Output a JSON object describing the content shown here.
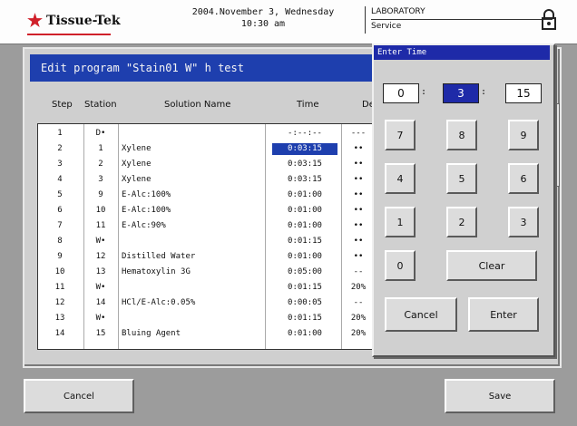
{
  "header": {
    "logo_text": "Tissue-Tek",
    "date_line": "2004.November 3, Wednesday",
    "time_line": "10:30 am",
    "lab_label": "LABORATORY",
    "lab_value": "Service",
    "colors": {
      "logo_star": "#d0202a",
      "title_bg": "#1e3fae"
    }
  },
  "editor": {
    "title": "Edit program \"Stain01 W\" h test",
    "columns": [
      "Step",
      "Station",
      "Solution Name",
      "Time",
      "Del"
    ],
    "rows": [
      {
        "step": "1",
        "station": "D•",
        "solution": "",
        "time": "-:--:--",
        "del": "---"
      },
      {
        "step": "2",
        "station": "1",
        "solution": "Xylene",
        "time": "0:03:15",
        "del": "••"
      },
      {
        "step": "3",
        "station": "2",
        "solution": "Xylene",
        "time": "0:03:15",
        "del": "••"
      },
      {
        "step": "4",
        "station": "3",
        "solution": "Xylene",
        "time": "0:03:15",
        "del": "••"
      },
      {
        "step": "5",
        "station": "9",
        "solution": "E-Alc:100%",
        "time": "0:01:00",
        "del": "••"
      },
      {
        "step": "6",
        "station": "10",
        "solution": "E-Alc:100%",
        "time": "0:01:00",
        "del": "••"
      },
      {
        "step": "7",
        "station": "11",
        "solution": "E-Alc:90%",
        "time": "0:01:00",
        "del": "••"
      },
      {
        "step": "8",
        "station": "W•",
        "solution": "",
        "time": "0:01:15",
        "del": "••"
      },
      {
        "step": "9",
        "station": "12",
        "solution": "Distilled Water",
        "time": "0:01:00",
        "del": "••"
      },
      {
        "step": "10",
        "station": "13",
        "solution": "Hematoxylin 3G",
        "time": "0:05:00",
        "del": "--"
      },
      {
        "step": "11",
        "station": "W•",
        "solution": "",
        "time": "0:01:15",
        "del": "20%"
      },
      {
        "step": "12",
        "station": "14",
        "solution": "HCl/E-Alc:0.05%",
        "time": "0:00:05",
        "del": "--"
      },
      {
        "step": "13",
        "station": "W•",
        "solution": "",
        "time": "0:01:15",
        "del": "20%"
      },
      {
        "step": "14",
        "station": "15",
        "solution": "Bluing Agent",
        "time": "0:01:00",
        "del": "20%"
      }
    ]
  },
  "dialog": {
    "title": "Enter Time",
    "hours": "0",
    "minutes": "3",
    "seconds": "15",
    "keys": [
      "7",
      "8",
      "9",
      "4",
      "5",
      "6",
      "1",
      "2",
      "3",
      "0"
    ],
    "clear_label": "Clear",
    "cancel_label": "Cancel",
    "enter_label": "Enter"
  },
  "footer": {
    "cancel_label": "Cancel",
    "save_label": "Save"
  }
}
